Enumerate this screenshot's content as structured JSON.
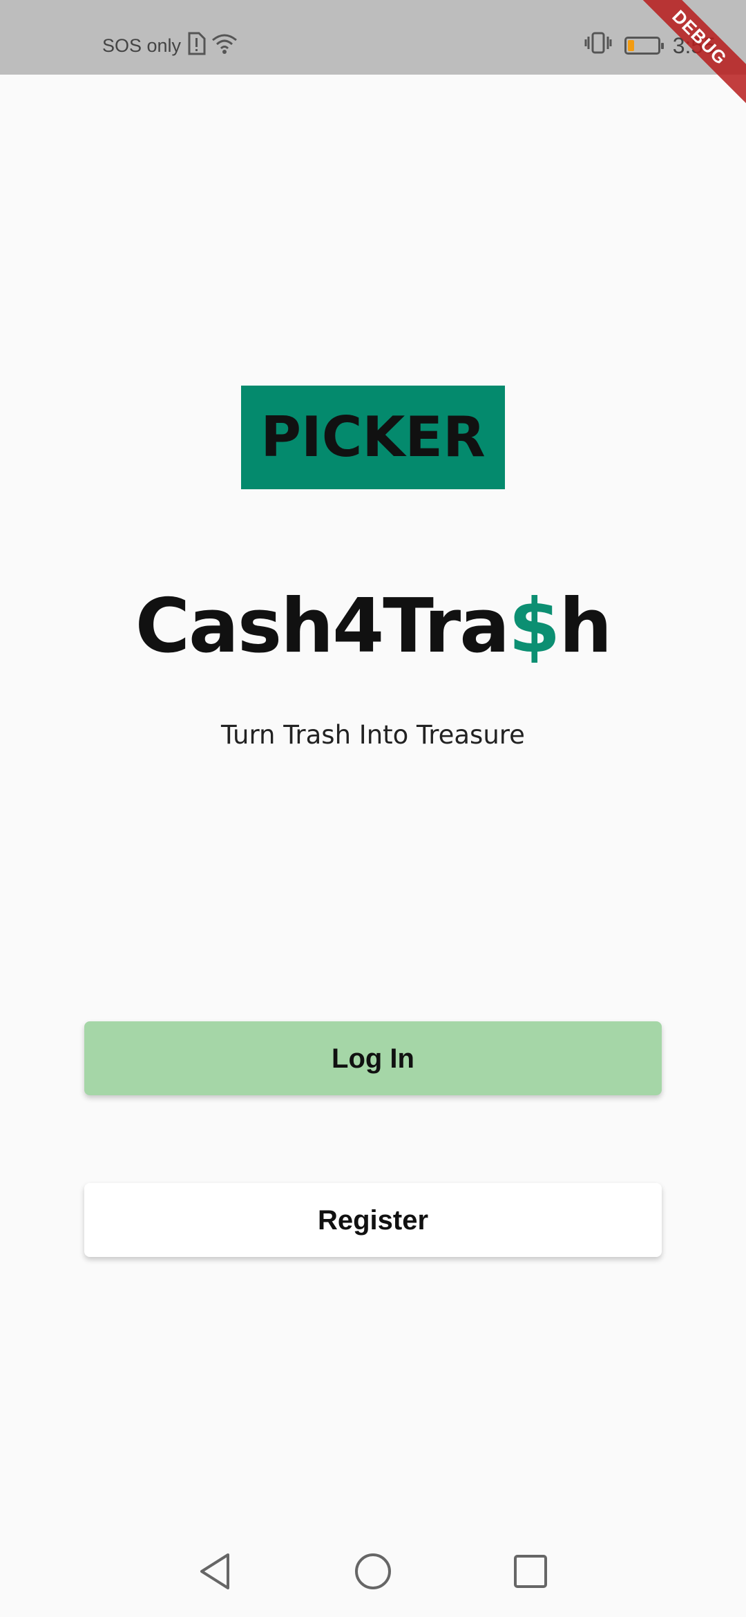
{
  "status_bar": {
    "carrier": "SOS only",
    "time": "3:55",
    "icons": [
      "sim-alert-icon",
      "wifi-icon",
      "vibrate-icon",
      "battery-icon"
    ],
    "battery_level": 0.2,
    "battery_color": "#f39c12"
  },
  "debug_banner": "DEBUG",
  "app": {
    "role_badge": "PICKER",
    "brand_prefix": "Cash4Tra",
    "brand_accent": "$",
    "brand_suffix": "h",
    "tagline": "Turn Trash Into Treasure",
    "accent_color": "#0c8f72"
  },
  "actions": {
    "login_label": "Log In",
    "register_label": "Register",
    "login_color": "#a5d6a7"
  },
  "nav": {
    "icons": [
      "back-icon",
      "home-icon",
      "recents-icon"
    ]
  }
}
